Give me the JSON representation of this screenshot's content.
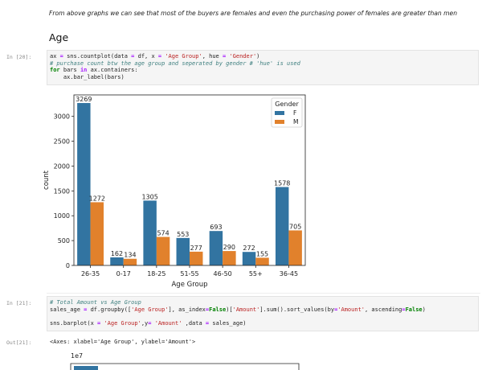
{
  "markdown": {
    "text": "From above graphs we can see that most of the buyers are females and even the purchasing power of females are greater than men",
    "heading": "Age"
  },
  "cells": [
    {
      "prompt": "In [20]:",
      "lines": [
        "ax = sns.countplot(data = df, x = 'Age Group', hue = 'Gender')",
        "# purchase count btw the age group and seperated by gender # 'hue' is used",
        "for bars in ax.containers:",
        "    ax.bar_label(bars)"
      ]
    },
    {
      "prompt": "In [21]:",
      "lines": [
        "# Total Amount vs Age Group",
        "sales_age = df.groupby(['Age Group'], as_index=False)['Amount'].sum().sort_values(by='Amount', ascending=False)",
        "",
        "sns.barplot(x = 'Age Group',y= 'Amount' ,data = sales_age)"
      ]
    }
  ],
  "output": {
    "prompt": "Out[21]:",
    "text": "<Axes: xlabel='Age Group', ylabel='Amount'>"
  },
  "chart_data": [
    {
      "type": "bar",
      "categories": [
        "26-35",
        "0-17",
        "18-25",
        "51-55",
        "46-50",
        "55+",
        "36-45"
      ],
      "series": [
        {
          "name": "F",
          "values": [
            3269,
            162,
            1305,
            553,
            693,
            272,
            1578
          ],
          "color": "#3274a1"
        },
        {
          "name": "M",
          "values": [
            1272,
            134,
            574,
            277,
            290,
            155,
            705
          ],
          "color": "#e1812c"
        }
      ],
      "data_labels": [
        [
          "3269",
          "162",
          "1305",
          "553",
          "693",
          "272",
          "1578"
        ],
        [
          "1272",
          "134",
          "574",
          "277",
          "290",
          "155",
          "705"
        ]
      ],
      "xlabel": "Age Group",
      "ylabel": "count",
      "yticks": [
        "0",
        "500",
        "1000",
        "1500",
        "2000",
        "2500",
        "3000"
      ],
      "ylim": [
        0,
        3432
      ],
      "legend_title": "Gender",
      "legend_position": "upper right",
      "grid": false
    },
    {
      "type": "bar",
      "categories": [],
      "values": [],
      "scale_label": "1e7",
      "note": "partially visible, cut off at bottom"
    }
  ]
}
